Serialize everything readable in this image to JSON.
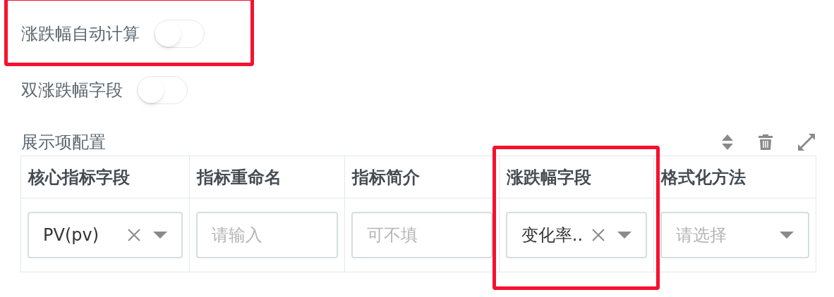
{
  "switches": [
    {
      "label": "涨跌幅自动计算",
      "on": false
    },
    {
      "label": "双涨跌幅字段",
      "on": false
    }
  ],
  "display_config": {
    "title": "展示项配置",
    "columns": [
      "核心指标字段",
      "指标重命名",
      "指标简介",
      "涨跌幅字段",
      "格式化方法"
    ],
    "rows": [
      [
        {
          "kind": "select",
          "value": "PV(pv)",
          "clearable": true
        },
        {
          "kind": "input",
          "placeholder": "请输入"
        },
        {
          "kind": "input",
          "placeholder": "可不填"
        },
        {
          "kind": "select",
          "value": "变化率..",
          "clearable": true
        },
        {
          "kind": "select",
          "placeholder": "请选择",
          "clearable": false
        }
      ]
    ]
  }
}
